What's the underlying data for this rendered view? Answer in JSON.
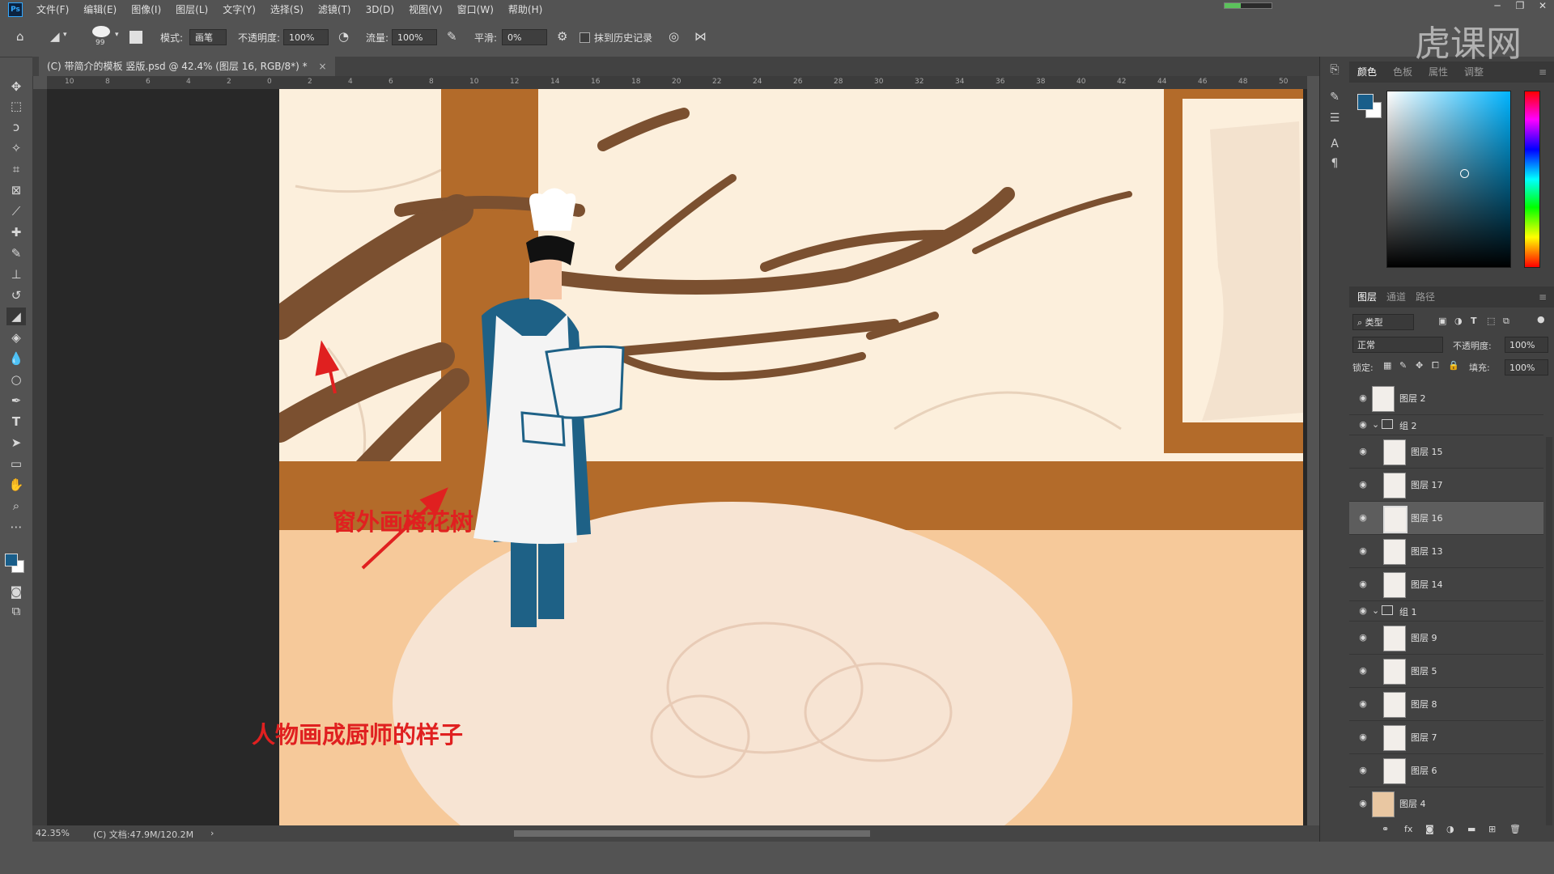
{
  "app": {
    "logo": "Ps"
  },
  "menu": [
    "文件(F)",
    "编辑(E)",
    "图像(I)",
    "图层(L)",
    "文字(Y)",
    "选择(S)",
    "滤镜(T)",
    "3D(D)",
    "视图(V)",
    "窗口(W)",
    "帮助(H)"
  ],
  "options": {
    "brush_size": "99",
    "mode_label": "模式:",
    "mode_value": "画笔",
    "opacity_label": "不透明度:",
    "opacity_value": "100%",
    "flow_label": "流量:",
    "flow_value": "100%",
    "smooth_label": "平滑:",
    "smooth_value": "0%",
    "erase_history_label": "抹到历史记录"
  },
  "document": {
    "tab_title": "(C) 带简介的模板 竖版.psd @ 42.4% (图层 16, RGB/8*) *",
    "zoom": "42.35%",
    "doc_info": "(C) 文档:47.9M/120.2M"
  },
  "ruler_labels": [
    "10",
    "8",
    "6",
    "4",
    "2",
    "0",
    "2",
    "4",
    "6",
    "8",
    "10",
    "12",
    "14",
    "16",
    "18",
    "20",
    "22",
    "24",
    "26",
    "28",
    "30",
    "32",
    "34",
    "36",
    "38",
    "40",
    "42",
    "44",
    "46",
    "48",
    "50"
  ],
  "annotations": {
    "tree": "窗外画梅花树",
    "chef": "人物画成厨师的样子"
  },
  "color_panel": {
    "tabs": [
      "颜色",
      "色板",
      "属性",
      "调整"
    ],
    "foreground": "#195e8a",
    "background": "#ffffff"
  },
  "layers_panel": {
    "tabs": [
      "图层",
      "通道",
      "路径"
    ],
    "filter_kind": "类型",
    "blend_mode": "正常",
    "opacity_label": "不透明度:",
    "opacity_value": "100%",
    "lock_label": "锁定:",
    "fill_label": "填充:",
    "fill_value": "100%",
    "layers": [
      {
        "name": "图层 2",
        "type": "layer",
        "indent": false
      },
      {
        "name": "组 2",
        "type": "group"
      },
      {
        "name": "图层 15",
        "type": "layer",
        "indent": true
      },
      {
        "name": "图层 17",
        "type": "layer",
        "indent": true
      },
      {
        "name": "图层 16",
        "type": "layer",
        "indent": true,
        "selected": true
      },
      {
        "name": "图层 13",
        "type": "layer",
        "indent": true
      },
      {
        "name": "图层 14",
        "type": "layer",
        "indent": true
      },
      {
        "name": "组 1",
        "type": "group"
      },
      {
        "name": "图层 9",
        "type": "layer",
        "indent": true
      },
      {
        "name": "图层 5",
        "type": "layer",
        "indent": true
      },
      {
        "name": "图层 8",
        "type": "layer",
        "indent": true
      },
      {
        "name": "图层 7",
        "type": "layer",
        "indent": true
      },
      {
        "name": "图层 6",
        "type": "layer",
        "indent": true
      },
      {
        "name": "图层 4",
        "type": "layer",
        "indent": false
      }
    ]
  },
  "watermark": "虎课网"
}
